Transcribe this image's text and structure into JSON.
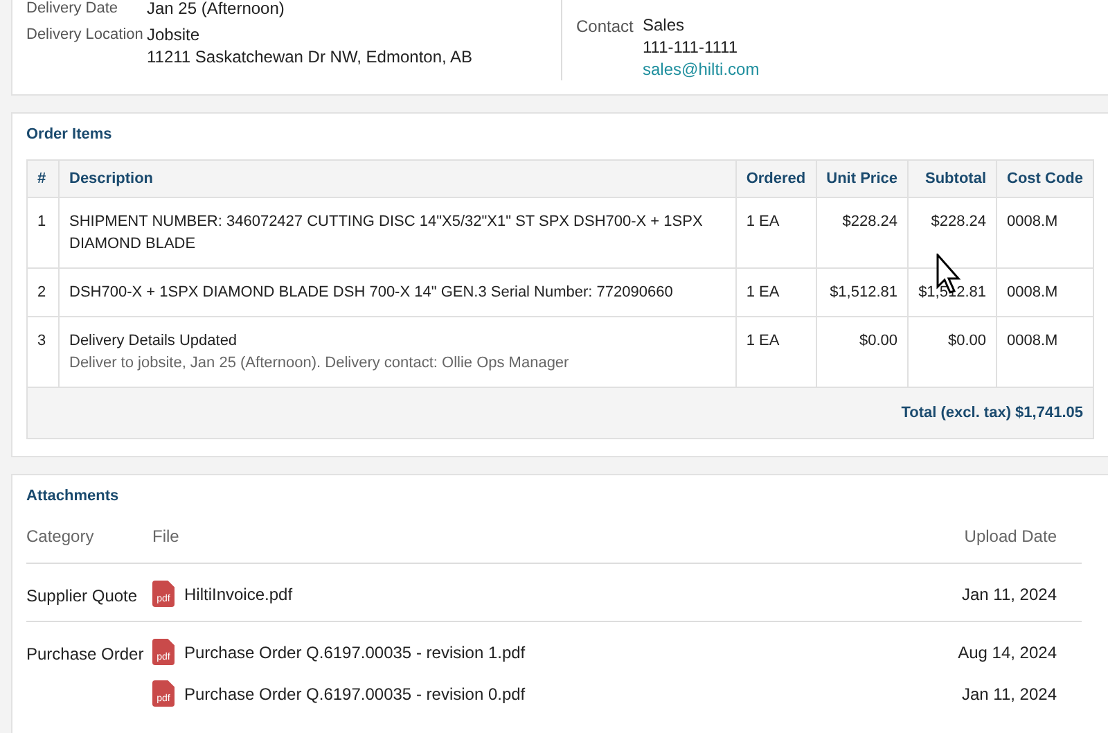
{
  "delivery": {
    "fields": [
      {
        "label": "Delivery Date",
        "lines": [
          "Jan 25 (Afternoon)"
        ]
      },
      {
        "label": "Delivery Location",
        "lines": [
          "Jobsite",
          "11211 Saskatchewan Dr NW, Edmonton, AB"
        ]
      }
    ],
    "contact": {
      "label": "Contact",
      "name": "Sales",
      "phone": "111-111-1111",
      "email": "sales@hilti.com"
    }
  },
  "order_items": {
    "title": "Order Items",
    "columns": [
      "#",
      "Description",
      "Ordered",
      "Unit Price",
      "Subtotal",
      "Cost Code"
    ],
    "rows": [
      {
        "number": "1",
        "description": "SHIPMENT NUMBER: 346072427 CUTTING DISC 14\"X5/32\"X1\" ST SPX DSH700-X + 1SPX DIAMOND BLADE",
        "ordered": "1 EA",
        "unit_price": "$228.24",
        "subtotal": "$228.24",
        "cost_code": "0008.M"
      },
      {
        "number": "2",
        "description": "DSH700-X + 1SPX DIAMOND BLADE DSH 700-X 14\" GEN.3 Serial Number: 772090660",
        "ordered": "1 EA",
        "unit_price": "$1,512.81",
        "subtotal": "$1,512.81",
        "cost_code": "0008.M"
      },
      {
        "number": "3",
        "description": "Delivery Details Updated",
        "note": "Deliver to jobsite, Jan 25 (Afternoon). Delivery contact: Ollie Ops Manager",
        "ordered": "1 EA",
        "unit_price": "$0.00",
        "subtotal": "$0.00",
        "cost_code": "0008.M"
      }
    ],
    "total": "Total (excl. tax) $1,741.05"
  },
  "attachments": {
    "title": "Attachments",
    "columns": [
      "Category",
      "File",
      "Upload Date"
    ],
    "groups": [
      {
        "category": "Supplier Quote",
        "files": [
          {
            "icon_label": "pdf",
            "name": "HiltiInvoice.pdf",
            "date": "Jan 11, 2024"
          }
        ]
      },
      {
        "category": "Purchase Order",
        "files": [
          {
            "icon_label": "pdf",
            "name": "Purchase Order Q.6197.00035 - revision 1.pdf",
            "date": "Aug 14, 2024"
          },
          {
            "icon_label": "pdf",
            "name": "Purchase Order Q.6197.00035 - revision 0.pdf",
            "date": "Jan 11, 2024"
          }
        ]
      }
    ]
  }
}
